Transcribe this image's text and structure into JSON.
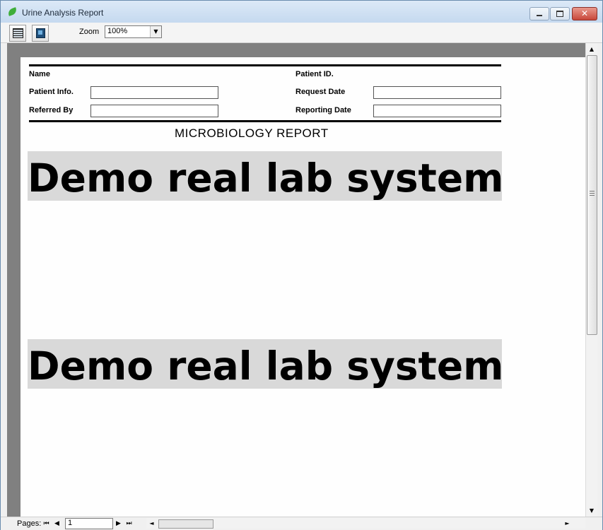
{
  "window": {
    "title": "Urine Analysis Report",
    "close_glyph": "✕"
  },
  "toolbar": {
    "print_icon": "printer-icon",
    "export_icon": "export-icon",
    "zoom_label": "Zoom",
    "zoom_value": "100%",
    "zoom_arrow": "▼"
  },
  "report": {
    "fields": {
      "name_label": "Name",
      "patient_id_label": "Patient ID.",
      "patient_info_label": "Patient Info.",
      "request_date_label": "Request Date",
      "referred_by_label": "Referred By",
      "reporting_date_label": "Reporting Date"
    },
    "heading": "MICROBIOLOGY  REPORT",
    "watermark_1": "Demo real lab system",
    "watermark_2": "Demo real lab system"
  },
  "scrollbar": {
    "up_arrow": "▲",
    "down_arrow": "▼",
    "left_arrow": "◄",
    "right_arrow": "►"
  },
  "statusbar": {
    "pages_label": "Pages:",
    "first_glyph": "⏮",
    "prev_glyph": "◀",
    "next_glyph": "▶",
    "last_glyph": "⏭",
    "page_value": "1"
  }
}
